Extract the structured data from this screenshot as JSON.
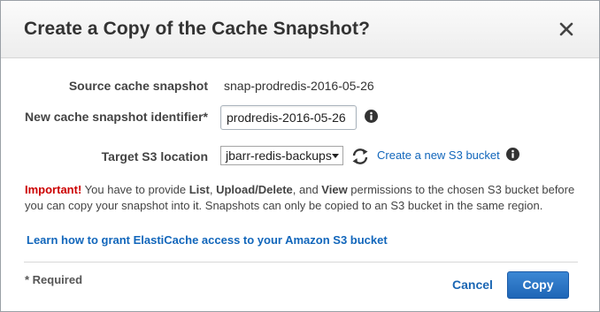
{
  "dialog": {
    "title": "Create a Copy of the Cache Snapshot?"
  },
  "form": {
    "source_label": "Source cache snapshot",
    "source_value": "snap-prodredis-2016-05-26",
    "identifier_label": "New cache snapshot identifier*",
    "identifier_value": "prodredis-2016-05-26",
    "target_label": "Target S3 location",
    "target_selected": "jbarr-redis-backups",
    "create_bucket_link": "Create a new S3 bucket"
  },
  "message": {
    "important": "Important!",
    "text_1": " You have to provide ",
    "perm_list": "List",
    "text_2": ", ",
    "perm_upload": "Upload/Delete",
    "text_3": ", and ",
    "perm_view": "View",
    "text_4": " permissions to the chosen S3 bucket before you can copy your snapshot into it. Snapshots can only be copied to an S3 bucket in the same region."
  },
  "learn_link": "Learn how to grant ElastiCache access to your Amazon S3 bucket",
  "footer": {
    "required_note": "* Required",
    "cancel_label": "Cancel",
    "copy_label": "Copy"
  },
  "colors": {
    "link": "#1166bb",
    "important": "#cc0000",
    "primary_button": "#2a76c6"
  }
}
